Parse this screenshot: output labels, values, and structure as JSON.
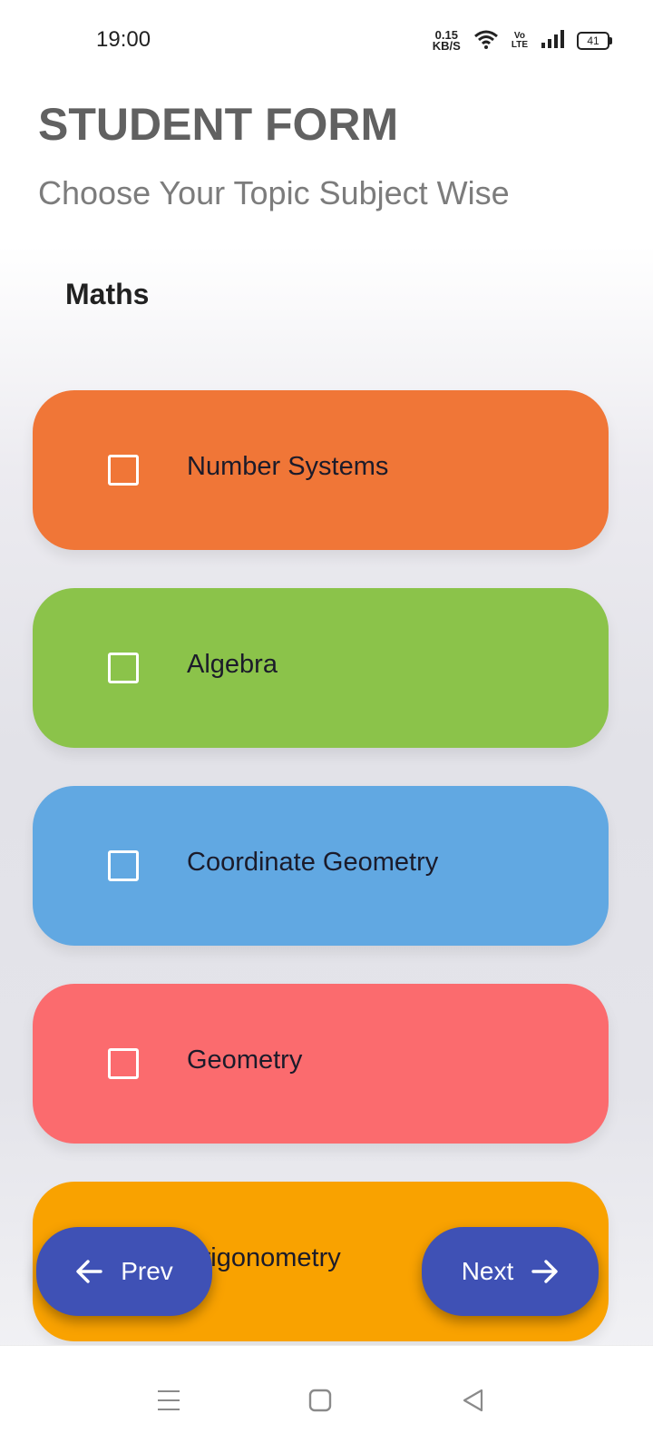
{
  "status_bar": {
    "time": "19:00",
    "net_speed_value": "0.15",
    "net_speed_unit": "KB/S",
    "volte_top": "Vo",
    "volte_bottom": "LTE",
    "battery": "41"
  },
  "header": {
    "title": "STUDENT FORM",
    "subtitle": "Choose Your Topic Subject Wise"
  },
  "subject": {
    "label": "Maths"
  },
  "topics": [
    {
      "label": "Number Systems",
      "color": "#f07637",
      "checked": false
    },
    {
      "label": "Algebra",
      "color": "#8bc34a",
      "checked": false
    },
    {
      "label": "Coordinate Geometry",
      "color": "#61a8e2",
      "checked": false
    },
    {
      "label": "Geometry",
      "color": "#fb6b6e",
      "checked": false
    },
    {
      "label": "Trigonometry",
      "color": "#f9a200",
      "checked": false
    }
  ],
  "buttons": {
    "prev_label": "Prev",
    "next_label": "Next",
    "accent": "#3f51b5"
  },
  "icons": {
    "prev": "arrow-left-icon",
    "next": "arrow-right-icon",
    "nav_menu": "menu-icon",
    "nav_home": "home-icon",
    "nav_back": "back-icon"
  }
}
